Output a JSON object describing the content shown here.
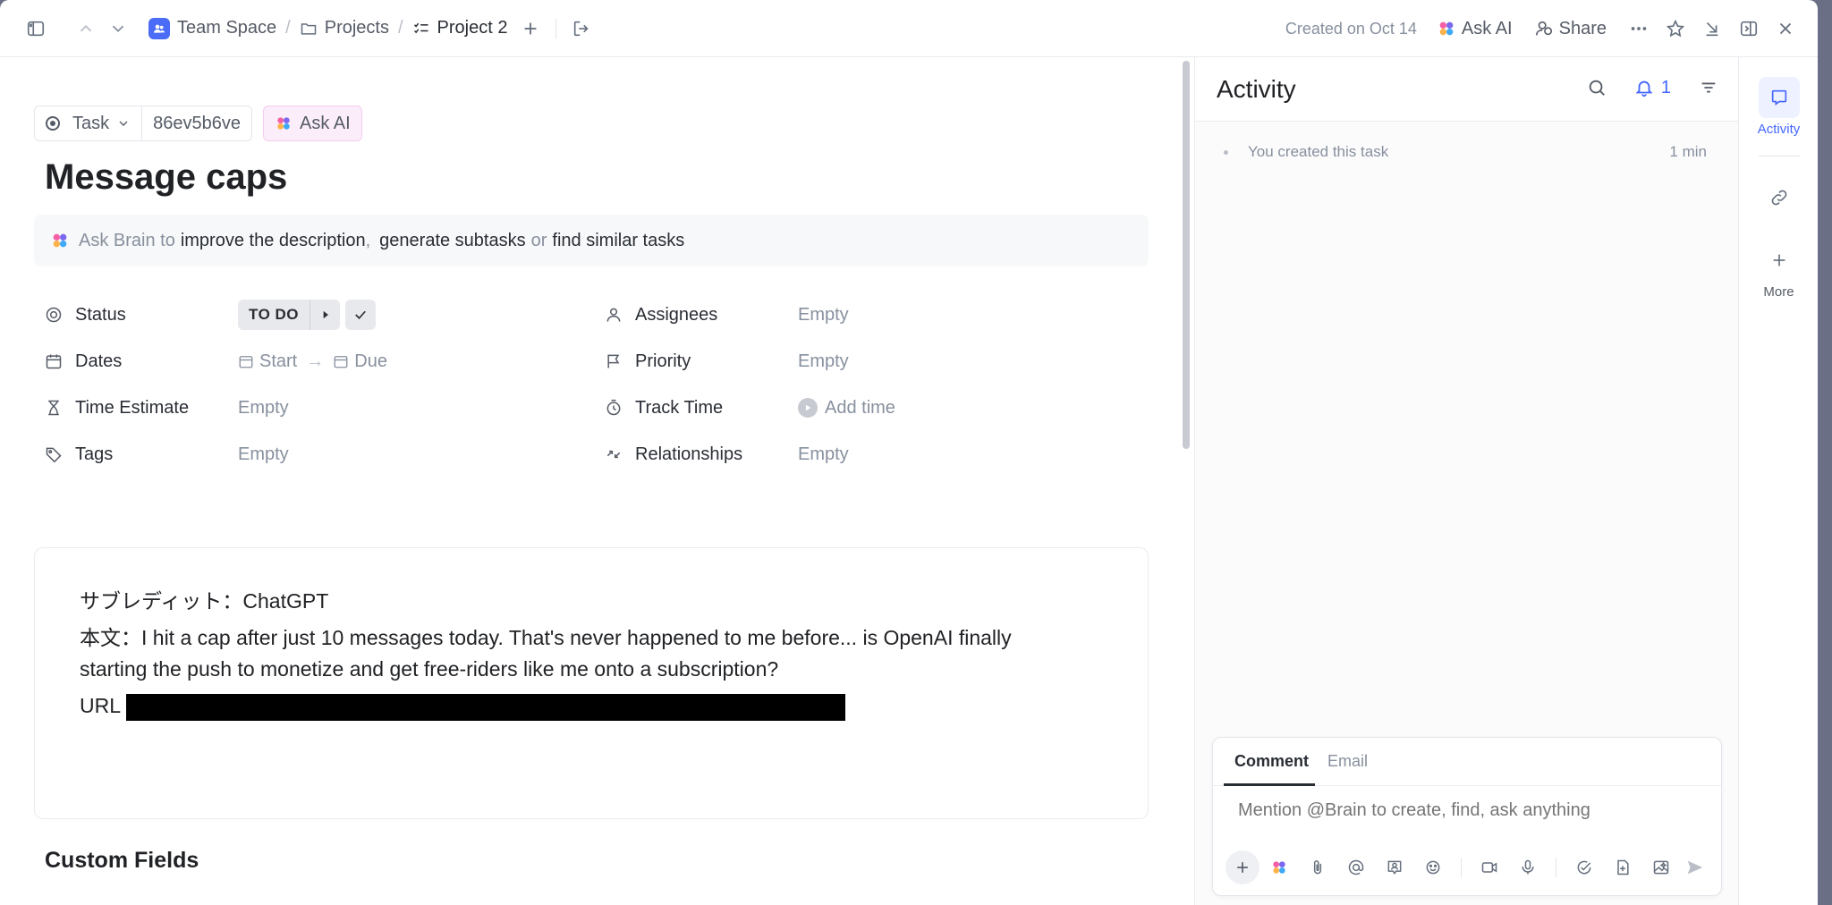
{
  "breadcrumb": {
    "space": "Team Space",
    "folder": "Projects",
    "list": "Project 2"
  },
  "topbar": {
    "created": "Created on Oct 14",
    "ask_ai": "Ask AI",
    "share": "Share"
  },
  "task": {
    "type": "Task",
    "id": "86ev5b6ve",
    "ask_ai": "Ask AI",
    "title": "Message caps"
  },
  "brain": {
    "prefix": "Ask Brain to",
    "link1": "improve the description",
    "comma": ",",
    "link2": "generate subtasks",
    "or": "or",
    "link3": "find similar tasks"
  },
  "fields": {
    "status_label": "Status",
    "status_value": "TO DO",
    "dates_label": "Dates",
    "dates_start": "Start",
    "dates_arrow": "→",
    "dates_due": "Due",
    "time_estimate_label": "Time Estimate",
    "time_estimate_value": "Empty",
    "tags_label": "Tags",
    "tags_value": "Empty",
    "assignees_label": "Assignees",
    "assignees_value": "Empty",
    "priority_label": "Priority",
    "priority_value": "Empty",
    "track_time_label": "Track Time",
    "track_time_value": "Add time",
    "relationships_label": "Relationships",
    "relationships_value": "Empty"
  },
  "description": {
    "line1": "サブレディット：ChatGPT",
    "line2": "本文：I hit a cap after just 10 messages today. That's never happened to me before... is OpenAI finally starting the push to monetize and get free-riders like me onto a subscription?",
    "url_label": "URL"
  },
  "custom_fields_heading": "Custom Fields",
  "activity": {
    "title": "Activity",
    "notif_count": "1",
    "items": [
      {
        "text": "You created this task",
        "time": "1 min"
      }
    ]
  },
  "comment": {
    "tab_comment": "Comment",
    "tab_email": "Email",
    "placeholder": "Mention @Brain to create, find, ask anything"
  },
  "rail": {
    "activity": "Activity",
    "more": "More"
  },
  "colors": {
    "accent": "#4466ff",
    "space_badge": "#4a6cf7"
  }
}
